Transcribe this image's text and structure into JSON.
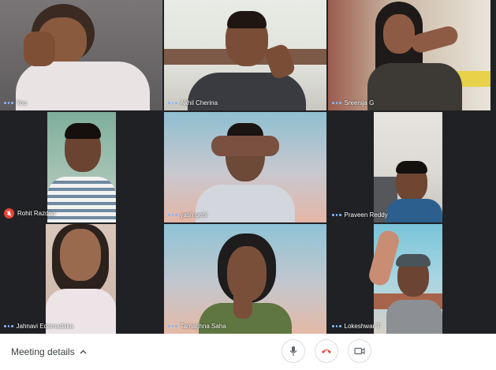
{
  "participants": [
    {
      "name": "You",
      "muted": false
    },
    {
      "name": "Akhil Cherina",
      "muted": false
    },
    {
      "name": "Sreenija G",
      "muted": false
    },
    {
      "name": "Rohit Razdan",
      "muted": true
    },
    {
      "name": "yash gehi",
      "muted": false
    },
    {
      "name": "Praveen Reddy",
      "muted": false
    },
    {
      "name": "Jahnavi Edamadaka",
      "muted": false
    },
    {
      "name": "Tamaghna Saha",
      "muted": false
    },
    {
      "name": "Lokeshwar T",
      "muted": false
    }
  ],
  "footer": {
    "meeting_details": "Meeting details"
  },
  "colors": {
    "background": "#202124",
    "speaking_dots": "#8ab4f8",
    "hangup": "#ea4335"
  },
  "icons": {
    "chevron": "chevron-up-icon",
    "mic": "mic-icon",
    "hangup": "hangup-icon",
    "camera": "camera-icon",
    "muted": "mic-off-icon"
  }
}
